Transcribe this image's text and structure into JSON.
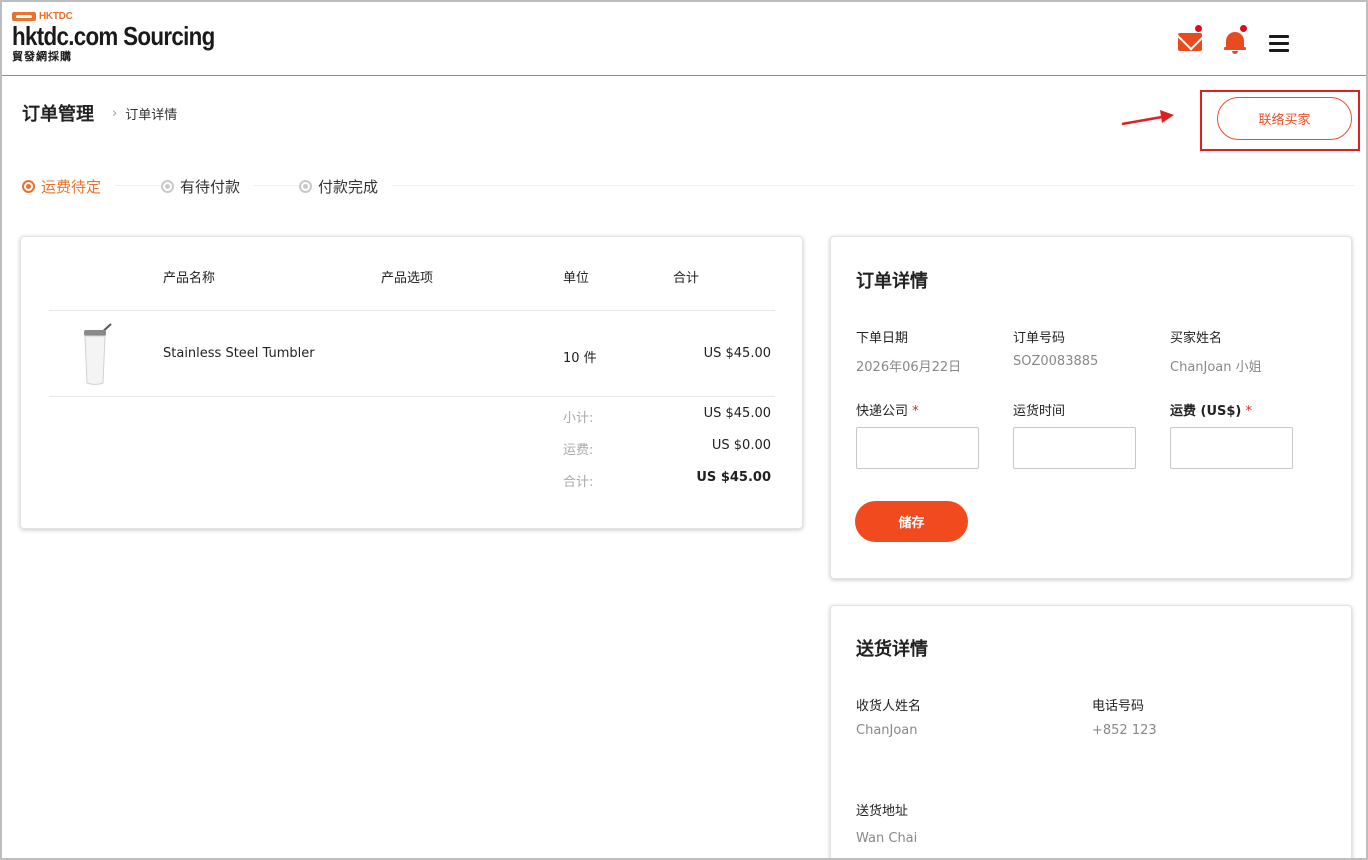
{
  "header": {
    "logo_small": "HKTDC",
    "logo_main": "hktdc.com Sourcing",
    "logo_sub": "貿發網採購",
    "mail_icon": "mail-icon",
    "bell_icon": "bell-icon",
    "menu_icon": "hamburger-menu-icon",
    "accent_color": "#e8732d"
  },
  "breadcrumb": {
    "title": "订单管理",
    "separator": "›",
    "current": "订单详情"
  },
  "contact_button": {
    "label": "联络买家"
  },
  "steps": [
    {
      "label": "运费待定",
      "active": true
    },
    {
      "label": "有待付款",
      "active": false
    },
    {
      "label": "付款完成",
      "active": false
    }
  ],
  "product_table": {
    "headers": {
      "name": "产品名称",
      "options": "产品选项",
      "unit": "单位",
      "total": "合计"
    },
    "rows": [
      {
        "name": "Stainless Steel Tumbler",
        "options": "",
        "unit": "10 件",
        "total": "US $45.00"
      }
    ],
    "summary": {
      "subtotal_label": "小计:",
      "subtotal": "US $45.00",
      "shipping_label": "运费:",
      "shipping": "US $0.00",
      "total_label": "合计:",
      "total": "US $45.00"
    }
  },
  "order_detail": {
    "title": "订单详情",
    "order_date_label": "下单日期",
    "order_date": "2026年06月22日",
    "order_no_label": "订单号码",
    "order_no": "SOZ0083885",
    "buyer_label": "买家姓名",
    "buyer": "ChanJoan 小姐",
    "courier_label": "快递公司",
    "courier_value": "",
    "ship_time_label": "运货时间",
    "ship_time_value": "",
    "freight_label": "运费 (US$)",
    "freight_value": "",
    "required_mark": "*",
    "save_label": "储存"
  },
  "shipping_detail": {
    "title": "送货详情",
    "recipient_label": "收货人姓名",
    "recipient": "ChanJoan",
    "phone_label": "电话号码",
    "phone": "+852 123",
    "address_label": "送货地址",
    "address": "Wan Chai"
  }
}
